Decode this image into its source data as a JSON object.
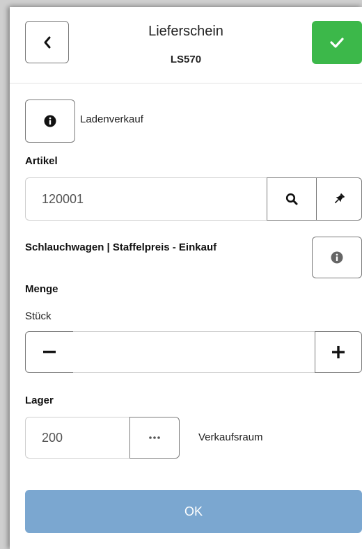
{
  "header": {
    "title": "Lieferschein",
    "subtitle": "LS570",
    "back_icon": "chevron-left-icon",
    "confirm_icon": "check-icon",
    "confirm_color": "#3cb84a"
  },
  "info": {
    "icon": "info-circle-icon",
    "text": "Ladenverkauf"
  },
  "artikel": {
    "label": "Artikel",
    "value": "120001",
    "search_icon": "search-icon",
    "pin_icon": "pin-icon",
    "description": "Schlauchwagen | Staffelpreis - Einkauf",
    "info_icon": "info-circle-icon"
  },
  "menge": {
    "label": "Menge",
    "unit": "Stück",
    "value": "",
    "minus_icon": "minus-icon",
    "plus_icon": "plus-icon"
  },
  "lager": {
    "label": "Lager",
    "value": "200",
    "more_icon": "ellipsis-icon",
    "name": "Verkaufsraum"
  },
  "footer": {
    "ok_label": "OK",
    "ok_color": "#7ba7d0"
  }
}
